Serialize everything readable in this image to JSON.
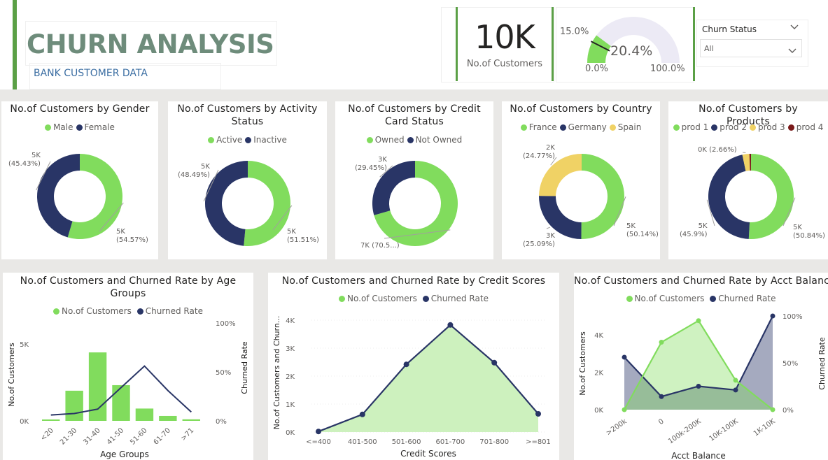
{
  "header": {
    "title": "CHURN ANALYSIS",
    "subtitle": "BANK CUSTOMER DATA",
    "kpi_value": "10K",
    "kpi_label": "No.of Customers",
    "gauge": {
      "value_label": "20.4%",
      "target_label": "15.0%",
      "min_label": "0.0%",
      "max_label": "100.0%",
      "value": 20.4,
      "target": 15.0
    },
    "filter": {
      "label": "Churn Status",
      "selected": "All"
    }
  },
  "colors": {
    "green": "#81DC5D",
    "navy": "#293566",
    "yellow": "#F0D265",
    "darkred": "#7A1A1A",
    "accent": "#5BA046"
  },
  "donuts": [
    {
      "title": "No.of Customers by Gender",
      "legend": [
        "Male",
        "Female"
      ],
      "slices": [
        {
          "name": "Male",
          "value": 54.57,
          "color": "#81DC5D",
          "label1": "5K",
          "label2": "(54.57%)"
        },
        {
          "name": "Female",
          "value": 45.43,
          "color": "#293566",
          "label1": "5K",
          "label2": "(45.43%)"
        }
      ]
    },
    {
      "title": "No.of Customers by Activity Status",
      "legend": [
        "Active",
        "Inactive"
      ],
      "slices": [
        {
          "name": "Active",
          "value": 51.51,
          "color": "#81DC5D",
          "label1": "5K",
          "label2": "(51.51%)"
        },
        {
          "name": "Inactive",
          "value": 48.49,
          "color": "#293566",
          "label1": "5K",
          "label2": "(48.49%)"
        }
      ]
    },
    {
      "title": "No.of Customers by Credit Card Status",
      "legend": [
        "Owned",
        "Not Owned"
      ],
      "slices": [
        {
          "name": "Owned",
          "value": 70.55,
          "color": "#81DC5D",
          "label1": "7K (70.5...)",
          "label2": ""
        },
        {
          "name": "Not Owned",
          "value": 29.45,
          "color": "#293566",
          "label1": "3K",
          "label2": "(29.45%)"
        }
      ]
    },
    {
      "title": "No.of Customers by Country",
      "legend": [
        "France",
        "Germany",
        "Spain"
      ],
      "slices": [
        {
          "name": "France",
          "value": 50.14,
          "color": "#81DC5D",
          "label1": "5K",
          "label2": "(50.14%)"
        },
        {
          "name": "Germany",
          "value": 25.09,
          "color": "#293566",
          "label1": "3K",
          "label2": "(25.09%)"
        },
        {
          "name": "Spain",
          "value": 24.77,
          "color": "#F0D265",
          "label1": "2K",
          "label2": "(24.77%)"
        }
      ]
    },
    {
      "title": "No.of Customers by Products",
      "legend": [
        "prod 1",
        "prod 2",
        "prod 3",
        "prod 4"
      ],
      "slices": [
        {
          "name": "prod 1",
          "value": 50.84,
          "color": "#81DC5D",
          "label1": "5K",
          "label2": "(50.84%)"
        },
        {
          "name": "prod 2",
          "value": 45.9,
          "color": "#293566",
          "label1": "5K",
          "label2": "(45.9%)"
        },
        {
          "name": "prod 3",
          "value": 2.66,
          "color": "#F0D265",
          "label1": "0K (2.66%)",
          "label2": ""
        },
        {
          "name": "prod 4",
          "value": 0.6,
          "color": "#7A1A1A",
          "label1": "",
          "label2": ""
        }
      ]
    }
  ],
  "combo_charts": {
    "age": {
      "title": "No.of Customers and Churned Rate by Age Groups",
      "legend": [
        "No.of Customers",
        "Churned Rate"
      ],
      "xlabel": "Age Groups",
      "ylabel_left": "No.of Customers",
      "ylabel_right": "Churned Rate",
      "left_ticks": [
        "5K",
        "0K"
      ],
      "right_ticks": [
        "100%",
        "50%",
        "0%"
      ]
    },
    "credit": {
      "title": "No.of Customers and Churned Rate by Credit Scores",
      "legend": [
        "No.of Customers",
        "Churned Rate"
      ],
      "xlabel": "Credit Scores",
      "ylabel_left": "No.of Customers and Churn...",
      "left_ticks": [
        "4K",
        "3K",
        "2K",
        "1K",
        "0K"
      ]
    },
    "balance": {
      "title": "No.of Customers and Churned Rate by Acct Balance",
      "legend": [
        "No.of Customers",
        "Churned Rate"
      ],
      "xlabel": "Acct Balance",
      "ylabel_left": "No.of Customers",
      "ylabel_right": "Churned Rate",
      "left_ticks": [
        "4K",
        "2K",
        "0K"
      ],
      "right_ticks": [
        "100%",
        "50%",
        "0%"
      ]
    }
  },
  "chart_data": [
    {
      "type": "pie",
      "title": "No.of Customers by Gender",
      "categories": [
        "Male",
        "Female"
      ],
      "values": [
        54.57,
        45.43
      ]
    },
    {
      "type": "pie",
      "title": "No.of Customers by Activity Status",
      "categories": [
        "Active",
        "Inactive"
      ],
      "values": [
        51.51,
        48.49
      ]
    },
    {
      "type": "pie",
      "title": "No.of Customers by Credit Card Status",
      "categories": [
        "Owned",
        "Not Owned"
      ],
      "values": [
        70.55,
        29.45
      ]
    },
    {
      "type": "pie",
      "title": "No.of Customers by Country",
      "categories": [
        "France",
        "Germany",
        "Spain"
      ],
      "values": [
        50.14,
        25.09,
        24.77
      ]
    },
    {
      "type": "pie",
      "title": "No.of Customers by Products",
      "categories": [
        "prod 1",
        "prod 2",
        "prod 3",
        "prod 4"
      ],
      "values": [
        50.84,
        45.9,
        2.66,
        0.6
      ]
    },
    {
      "type": "bar",
      "title": "No.of Customers and Churned Rate by Age Groups",
      "categories": [
        "<20",
        "21-30",
        "31-40",
        "41-50",
        "51-60",
        "61-70",
        ">71"
      ],
      "series": [
        {
          "name": "No.of Customers",
          "values": [
            90,
            1960,
            4450,
            2320,
            800,
            320,
            100
          ]
        },
        {
          "name": "Churned Rate",
          "values": [
            6,
            7.5,
            12,
            34,
            56,
            31,
            9
          ]
        }
      ],
      "xlabel": "Age Groups",
      "ylabel": "No.of Customers",
      "ylim": [
        0,
        6000
      ],
      "y2lim": [
        0,
        100
      ]
    },
    {
      "type": "area",
      "title": "No.of Customers and Churned Rate by Credit Scores",
      "categories": [
        "<=400",
        "401-500",
        "501-600",
        "601-700",
        "701-800",
        ">=801"
      ],
      "series": [
        {
          "name": "No.of Customers",
          "values": [
            20,
            630,
            2420,
            3830,
            2480,
            650
          ]
        },
        {
          "name": "Churned Rate",
          "values": [
            20,
            630,
            2420,
            3830,
            2480,
            650
          ]
        }
      ],
      "xlabel": "Credit Scores",
      "ylim": [
        0,
        4200
      ]
    },
    {
      "type": "area",
      "title": "No.of Customers and Churned Rate by Acct Balance",
      "categories": [
        ">200k",
        "0",
        "100k-200K",
        "10K-100K",
        "1K-10K"
      ],
      "series": [
        {
          "name": "No.of Customers",
          "values": [
            0,
            3600,
            4750,
            1570,
            0
          ]
        },
        {
          "name": "Churned Rate",
          "values": [
            56,
            14,
            25,
            21,
            100
          ]
        }
      ],
      "xlabel": "Acct Balance",
      "ylabel": "No.of Customers",
      "ylim": [
        0,
        5000
      ],
      "y2lim": [
        0,
        100
      ]
    }
  ]
}
